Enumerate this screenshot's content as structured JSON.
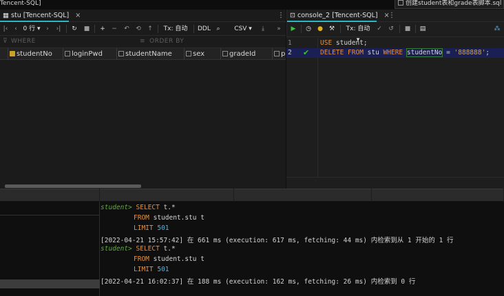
{
  "app": {
    "title": "Tencent-SQL]"
  },
  "file_tab": {
    "label": "创建student表和grade表脚本.sql"
  },
  "left": {
    "tab": {
      "label": "stu [Tencent-SQL]",
      "close": "×"
    },
    "toolbar": {
      "rows": "0 行",
      "tx": "Tx: 自动",
      "ddl": "DDL",
      "csv": "CSV"
    },
    "filters": {
      "where": "WHERE",
      "order_by": "ORDER BY"
    },
    "columns": [
      "studentNo",
      "loginPwd",
      "studentName",
      "sex",
      "gradeId",
      "p"
    ]
  },
  "right": {
    "tab": {
      "label": "console_2 [Tencent-SQL]",
      "close": "×"
    },
    "toolbar": {
      "tx": "Tx: 自动"
    },
    "lines": [
      {
        "num": "1",
        "kw1": "USE",
        "text": " student;"
      },
      {
        "num": "2",
        "kw1": "DELETE FROM",
        "mid": " stu ",
        "kw2": "WHERE",
        "col": "studentNo",
        "eq": " = ",
        "str": "'888888'",
        "end": ";"
      }
    ]
  },
  "output": {
    "prompt": "student>",
    "select": "SELECT",
    "select_cols": " t.*",
    "from": "FROM",
    "from_target": " student.stu t",
    "limit": "LIMIT",
    "limit_val": "501",
    "log1": "[2022-04-21 15:57:42] 在 661 ms (execution: 617 ms, fetching: 44 ms) 内检索到从 1 开始的 1 行",
    "log2": "[2022-04-21 16:02:37] 在 188 ms (execution: 162 ms, fetching: 26 ms) 内检索到 0 行"
  }
}
